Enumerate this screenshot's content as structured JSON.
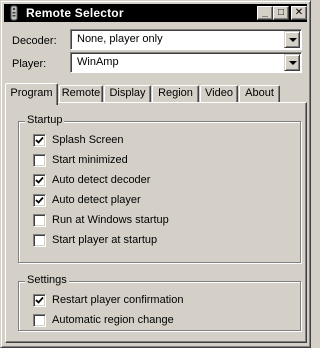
{
  "window": {
    "title": "Remote Selector",
    "minimize_glyph": "_",
    "maximize_glyph": "□",
    "close_glyph": "✕"
  },
  "decoder": {
    "label": "Decoder:",
    "value": "None, player only"
  },
  "player": {
    "label": "Player:",
    "value": "WinAmp"
  },
  "tabs": [
    {
      "label": "Program",
      "active": true
    },
    {
      "label": "Remote",
      "active": false
    },
    {
      "label": "Display",
      "active": false
    },
    {
      "label": "Region",
      "active": false
    },
    {
      "label": "Video",
      "active": false
    },
    {
      "label": "About",
      "active": false
    }
  ],
  "startup": {
    "title": "Startup",
    "items": [
      {
        "label": "Splash Screen",
        "checked": true
      },
      {
        "label": "Start minimized",
        "checked": false
      },
      {
        "label": "Auto detect decoder",
        "checked": true
      },
      {
        "label": "Auto detect player",
        "checked": true
      },
      {
        "label": "Run at Windows startup",
        "checked": false
      },
      {
        "label": "Start player at startup",
        "checked": false
      }
    ]
  },
  "settings": {
    "title": "Settings",
    "items": [
      {
        "label": "Restart player confirmation",
        "checked": true
      },
      {
        "label": "Automatic region change",
        "checked": false
      }
    ]
  }
}
